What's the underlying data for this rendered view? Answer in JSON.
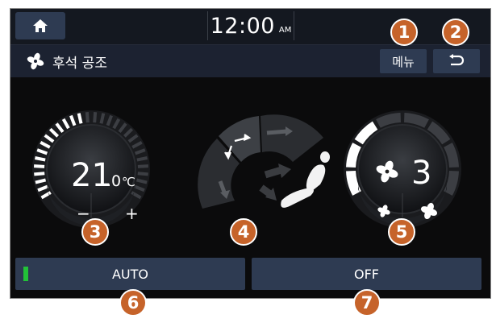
{
  "header": {
    "time": "12:00",
    "ampm": "AM"
  },
  "titlebar": {
    "title": "후석 공조",
    "menu_label": "메뉴"
  },
  "temperature": {
    "main": "21",
    "decimal": ".0",
    "unit": "℃",
    "minus_label": "−",
    "plus_label": "+"
  },
  "fan": {
    "level": "3"
  },
  "buttons": {
    "auto_label": "AUTO",
    "off_label": "OFF"
  },
  "callouts": [
    "1",
    "2",
    "3",
    "4",
    "5",
    "6",
    "7"
  ],
  "colors": {
    "button_bg": "#2e3b52",
    "callout": "#c6632a",
    "auto_indicator": "#22c338"
  }
}
